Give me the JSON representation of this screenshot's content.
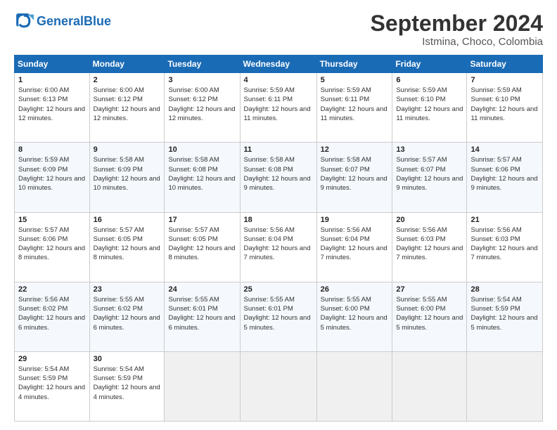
{
  "logo": {
    "text_general": "General",
    "text_blue": "Blue"
  },
  "title": "September 2024",
  "subtitle": "Istmina, Choco, Colombia",
  "headers": [
    "Sunday",
    "Monday",
    "Tuesday",
    "Wednesday",
    "Thursday",
    "Friday",
    "Saturday"
  ],
  "weeks": [
    [
      {
        "day": "1",
        "sunrise": "6:00 AM",
        "sunset": "6:13 PM",
        "daylight": "12 hours and 12 minutes."
      },
      {
        "day": "2",
        "sunrise": "6:00 AM",
        "sunset": "6:12 PM",
        "daylight": "12 hours and 12 minutes."
      },
      {
        "day": "3",
        "sunrise": "6:00 AM",
        "sunset": "6:12 PM",
        "daylight": "12 hours and 12 minutes."
      },
      {
        "day": "4",
        "sunrise": "5:59 AM",
        "sunset": "6:11 PM",
        "daylight": "12 hours and 11 minutes."
      },
      {
        "day": "5",
        "sunrise": "5:59 AM",
        "sunset": "6:11 PM",
        "daylight": "12 hours and 11 minutes."
      },
      {
        "day": "6",
        "sunrise": "5:59 AM",
        "sunset": "6:10 PM",
        "daylight": "12 hours and 11 minutes."
      },
      {
        "day": "7",
        "sunrise": "5:59 AM",
        "sunset": "6:10 PM",
        "daylight": "12 hours and 11 minutes."
      }
    ],
    [
      {
        "day": "8",
        "sunrise": "5:59 AM",
        "sunset": "6:09 PM",
        "daylight": "12 hours and 10 minutes."
      },
      {
        "day": "9",
        "sunrise": "5:58 AM",
        "sunset": "6:09 PM",
        "daylight": "12 hours and 10 minutes."
      },
      {
        "day": "10",
        "sunrise": "5:58 AM",
        "sunset": "6:08 PM",
        "daylight": "12 hours and 10 minutes."
      },
      {
        "day": "11",
        "sunrise": "5:58 AM",
        "sunset": "6:08 PM",
        "daylight": "12 hours and 9 minutes."
      },
      {
        "day": "12",
        "sunrise": "5:58 AM",
        "sunset": "6:07 PM",
        "daylight": "12 hours and 9 minutes."
      },
      {
        "day": "13",
        "sunrise": "5:57 AM",
        "sunset": "6:07 PM",
        "daylight": "12 hours and 9 minutes."
      },
      {
        "day": "14",
        "sunrise": "5:57 AM",
        "sunset": "6:06 PM",
        "daylight": "12 hours and 9 minutes."
      }
    ],
    [
      {
        "day": "15",
        "sunrise": "5:57 AM",
        "sunset": "6:06 PM",
        "daylight": "12 hours and 8 minutes."
      },
      {
        "day": "16",
        "sunrise": "5:57 AM",
        "sunset": "6:05 PM",
        "daylight": "12 hours and 8 minutes."
      },
      {
        "day": "17",
        "sunrise": "5:57 AM",
        "sunset": "6:05 PM",
        "daylight": "12 hours and 8 minutes."
      },
      {
        "day": "18",
        "sunrise": "5:56 AM",
        "sunset": "6:04 PM",
        "daylight": "12 hours and 7 minutes."
      },
      {
        "day": "19",
        "sunrise": "5:56 AM",
        "sunset": "6:04 PM",
        "daylight": "12 hours and 7 minutes."
      },
      {
        "day": "20",
        "sunrise": "5:56 AM",
        "sunset": "6:03 PM",
        "daylight": "12 hours and 7 minutes."
      },
      {
        "day": "21",
        "sunrise": "5:56 AM",
        "sunset": "6:03 PM",
        "daylight": "12 hours and 7 minutes."
      }
    ],
    [
      {
        "day": "22",
        "sunrise": "5:56 AM",
        "sunset": "6:02 PM",
        "daylight": "12 hours and 6 minutes."
      },
      {
        "day": "23",
        "sunrise": "5:55 AM",
        "sunset": "6:02 PM",
        "daylight": "12 hours and 6 minutes."
      },
      {
        "day": "24",
        "sunrise": "5:55 AM",
        "sunset": "6:01 PM",
        "daylight": "12 hours and 6 minutes."
      },
      {
        "day": "25",
        "sunrise": "5:55 AM",
        "sunset": "6:01 PM",
        "daylight": "12 hours and 5 minutes."
      },
      {
        "day": "26",
        "sunrise": "5:55 AM",
        "sunset": "6:00 PM",
        "daylight": "12 hours and 5 minutes."
      },
      {
        "day": "27",
        "sunrise": "5:55 AM",
        "sunset": "6:00 PM",
        "daylight": "12 hours and 5 minutes."
      },
      {
        "day": "28",
        "sunrise": "5:54 AM",
        "sunset": "5:59 PM",
        "daylight": "12 hours and 5 minutes."
      }
    ],
    [
      {
        "day": "29",
        "sunrise": "5:54 AM",
        "sunset": "5:59 PM",
        "daylight": "12 hours and 4 minutes."
      },
      {
        "day": "30",
        "sunrise": "5:54 AM",
        "sunset": "5:59 PM",
        "daylight": "12 hours and 4 minutes."
      },
      null,
      null,
      null,
      null,
      null
    ]
  ]
}
